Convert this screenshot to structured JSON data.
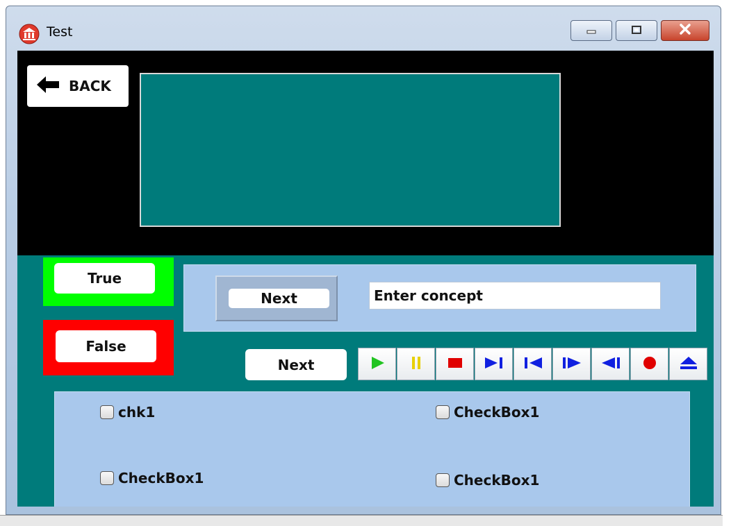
{
  "window": {
    "title": "Test",
    "icon": "app-bank-icon"
  },
  "title_buttons": {
    "minimize_icon": "minimize-icon",
    "maximize_icon": "maximize-icon",
    "close_icon": "close-icon"
  },
  "back_button": {
    "label": "BACK",
    "icon": "arrow-left-icon"
  },
  "true_button": {
    "label": "True",
    "frame_color": "#00ff00"
  },
  "false_button": {
    "label": "False",
    "frame_color": "#ff0000"
  },
  "concept": {
    "next_label": "Next",
    "input_value": "Enter concept"
  },
  "next_button_2": {
    "label": "Next"
  },
  "media_buttons": [
    "play",
    "pause",
    "stop",
    "next-track",
    "previous-track",
    "step-forward",
    "step-back",
    "record",
    "eject"
  ],
  "checkboxes": [
    {
      "label": "chk1",
      "checked": false
    },
    {
      "label": "CheckBox1",
      "checked": false
    },
    {
      "label": "CheckBox1",
      "checked": false
    },
    {
      "label": "CheckBox1",
      "checked": false
    }
  ],
  "colors": {
    "panel_teal": "#007b7b",
    "panel_blue": "#a9c8ec",
    "black": "#000000"
  }
}
